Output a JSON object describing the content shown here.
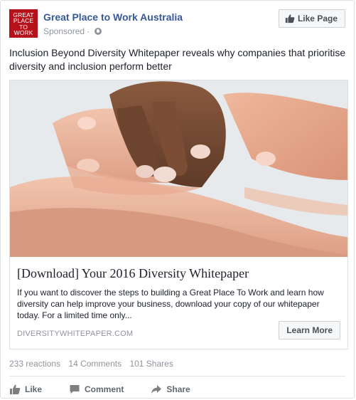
{
  "page": {
    "name": "Great Place to Work Australia",
    "sponsored_label": "Sponsored",
    "separator": "·",
    "logo_lines": [
      "Great",
      "Place",
      "to",
      "Work"
    ],
    "like_page_label": "Like Page"
  },
  "post": {
    "text": "Inclusion Beyond Diversity Whitepaper reveals why companies that prioritise diversity and inclusion perform better"
  },
  "attachment": {
    "title": "[Download] Your 2016 Diversity Whitepaper",
    "description": "If you want to discover the steps to building a Great Place To Work and learn how diversity can help improve your business, download your copy of our whitepaper today. For a limited time only...",
    "domain": "DIVERSITYWHITEPAPER.COM",
    "cta_label": "Learn More"
  },
  "stats": {
    "reactions": "233 reactions",
    "comments": "14 Comments",
    "shares": "101 Shares"
  },
  "actions": {
    "like": "Like",
    "comment": "Comment",
    "share": "Share"
  },
  "colors": {
    "brand_red": "#b5121b",
    "link_blue": "#365899",
    "meta_gray": "#90949c"
  }
}
